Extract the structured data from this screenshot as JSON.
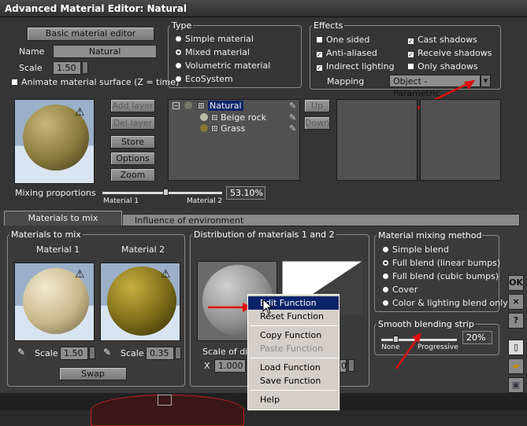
{
  "window": {
    "title": "Advanced Material Editor: Natural"
  },
  "basic": {
    "button": "Basic material editor",
    "name_label": "Name",
    "name_value": "Natural",
    "scale_label": "Scale",
    "scale_value": "1.50",
    "animate_label": "Animate material surface (Z = time)"
  },
  "type_group": {
    "title": "Type",
    "options": [
      "Simple material",
      "Mixed material",
      "Volumetric material",
      "EcoSystem"
    ],
    "selected": "Mixed material"
  },
  "effects": {
    "title": "Effects",
    "one_sided": "One sided",
    "cast_shadows": "Cast shadows",
    "anti_aliased": "Anti-aliased",
    "receive_shadows": "Receive shadows",
    "indirect_lighting": "Indirect lighting",
    "only_shadows": "Only shadows",
    "mapping_label": "Mapping",
    "mapping_value": "Object - Parametric"
  },
  "layers": {
    "add": "Add layer",
    "del": "Del layer",
    "store": "Store",
    "options": "Options",
    "zoom": "Zoom",
    "up": "Up",
    "down": "Down",
    "tree": [
      {
        "label": "Natural"
      },
      {
        "label": "Beige rock"
      },
      {
        "label": "Grass"
      }
    ]
  },
  "mixing": {
    "label": "Mixing proportions",
    "m1": "Material 1",
    "m2": "Material 2",
    "value": "53.10%",
    "fraction": 0.531
  },
  "tabs": {
    "mix": "Materials to mix",
    "env": "Influence of environment"
  },
  "mats": {
    "title": "Materials to mix",
    "m1": "Material 1",
    "m2": "Material 2",
    "scale_label": "Scale",
    "scale1": "1.50",
    "scale2": "0.35",
    "swap": "Swap"
  },
  "dist": {
    "title": "Distribution of materials 1 and 2",
    "scale_label": "Scale of dis",
    "x_prefix": "X",
    "x_value": "1.000",
    "partial": "0"
  },
  "method": {
    "title": "Material mixing method",
    "options": [
      "Simple blend",
      "Full blend (linear bumps)",
      "Full blend (cubic bumps)",
      "Cover",
      "Color & lighting blend only"
    ],
    "selected": "Full blend (linear bumps)"
  },
  "strip": {
    "title": "Smooth blending strip",
    "none": "None",
    "progressive": "Progressive",
    "value": "20%",
    "fraction": 0.2
  },
  "side": {
    "ok": "OK",
    "close": "×",
    "help": "?"
  },
  "context_menu": {
    "items": [
      "Edit Function",
      "Reset Function",
      "Copy Function",
      "Paste Function",
      "Load Function",
      "Save Function",
      "Help"
    ]
  },
  "colors": {
    "accent": "#0a246a",
    "arrow": "#e01010"
  }
}
